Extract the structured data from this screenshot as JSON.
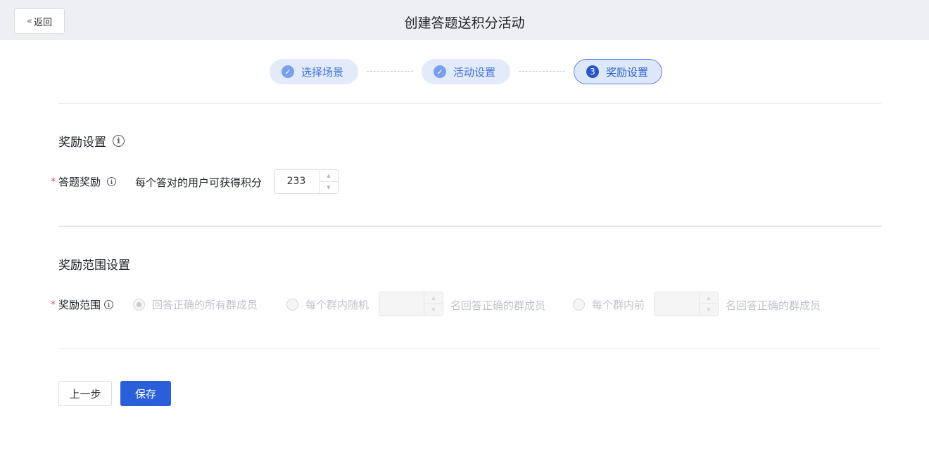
{
  "header": {
    "back_label": "返回",
    "title": "创建答题送积分活动"
  },
  "steps": [
    {
      "label": "选择场景",
      "status": "done",
      "icon": "check-icon"
    },
    {
      "label": "活动设置",
      "status": "done",
      "icon": "check-icon"
    },
    {
      "label": "奖励设置",
      "status": "active",
      "number": "3"
    }
  ],
  "reward_section": {
    "title": "奖励设置",
    "field_label": "答题奖励",
    "field_text": "每个答对的用户可获得积分",
    "points_value": "233"
  },
  "scope_section": {
    "title": "奖励范围设置",
    "field_label": "奖励范围",
    "option_all": "回答正确的所有群成员",
    "option_random_prefix": "每个群内随机",
    "option_random_suffix": "名回答正确的群成员",
    "option_top_prefix": "每个群内前",
    "option_top_suffix": "名回答正确的群成员",
    "selected": "option_all",
    "disabled": true
  },
  "footer": {
    "prev_label": "上一步",
    "save_label": "保存"
  },
  "colors": {
    "primary": "#2b5fd9",
    "step_done_bg": "#e3ebfb",
    "required": "#e34d59"
  }
}
